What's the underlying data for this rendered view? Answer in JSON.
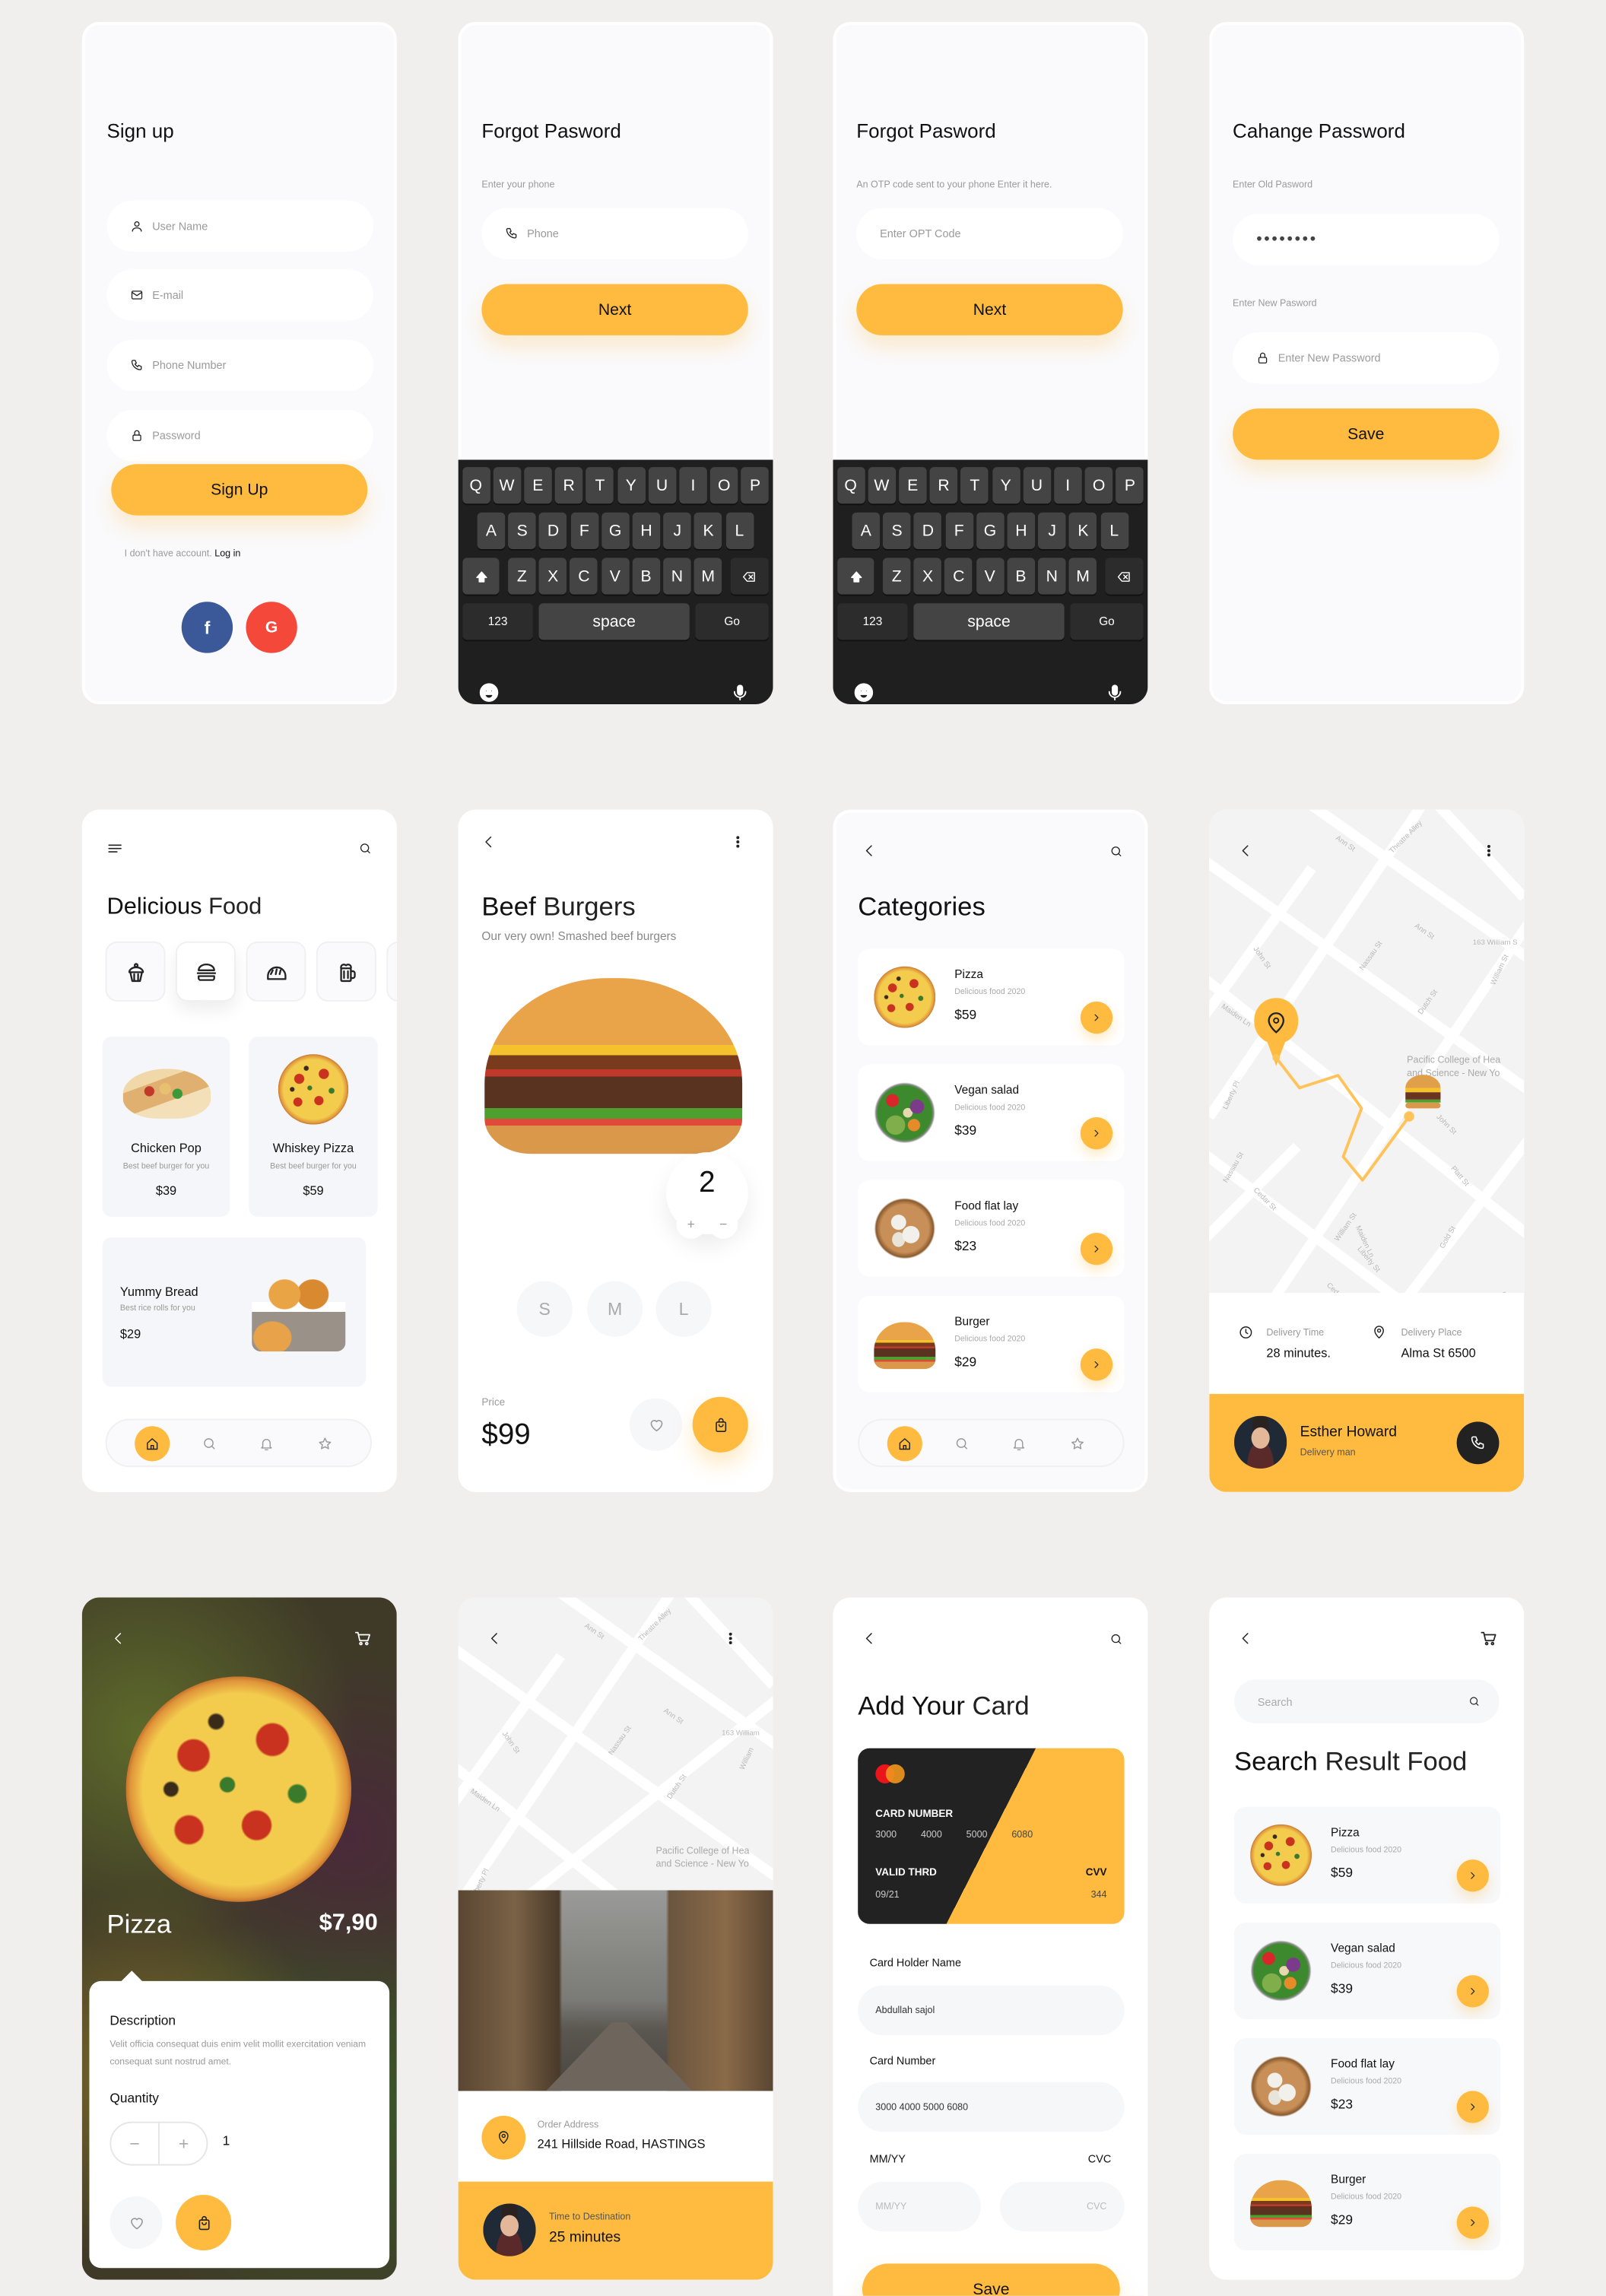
{
  "colors": {
    "accent": "#FFBB3F",
    "background": "#F0EFED",
    "keyboard": "#1F1F1F",
    "facebook": "#3B5998",
    "google": "#F4483A",
    "dark_button": "#222222"
  },
  "signup": {
    "title": "Sign up",
    "fields": [
      {
        "placeholder": "User Name",
        "icon": "user-icon"
      },
      {
        "placeholder": "E-mail",
        "icon": "mail-icon"
      },
      {
        "placeholder": "Phone Number",
        "icon": "phone-icon"
      },
      {
        "placeholder": "Password",
        "icon": "lock-icon"
      }
    ],
    "button": "Sign Up",
    "footer_text": "I don't have account.",
    "login_link": "Log in",
    "social": {
      "facebook": "f",
      "google": "G"
    }
  },
  "forgot_phone": {
    "title": "Forgot Pasword",
    "label": "Enter your phone",
    "placeholder": "Phone",
    "button": "Next"
  },
  "forgot_otp": {
    "title": "Forgot Pasword",
    "label": "An OTP code sent to your phone Enter it here.",
    "placeholder": "Enter OPT Code",
    "button": "Next"
  },
  "keyboard": {
    "rows": [
      [
        "Q",
        "W",
        "E",
        "R",
        "T",
        "Y",
        "U",
        "I",
        "O",
        "P"
      ],
      [
        "A",
        "S",
        "D",
        "F",
        "G",
        "H",
        "J",
        "K",
        "L"
      ],
      [
        "Z",
        "X",
        "C",
        "V",
        "B",
        "N",
        "M"
      ]
    ],
    "numbers": "123",
    "space": "space",
    "go": "Go"
  },
  "change_password": {
    "title": "Cahange Password",
    "old_label": "Enter Old Pasword",
    "old_value": "●●●●●●●●",
    "new_label": "Enter New Pasword",
    "new_placeholder": "Enter New Password",
    "button": "Save"
  },
  "home": {
    "title_bold": "Delicious",
    "title_light": "Food",
    "category_icons": [
      "cupcake-icon",
      "burger-icon",
      "bread-icon",
      "drink-icon"
    ],
    "selected_category": "burger-icon",
    "foods": [
      {
        "name": "Chicken Pop",
        "desc": "Best beef burger for you",
        "price": "$39",
        "image": "tacos"
      },
      {
        "name": "Whiskey Pizza",
        "desc": "Best beef burger for you",
        "price": "$59",
        "image": "pizza"
      }
    ],
    "featured": {
      "name": "Yummy Bread",
      "desc": "Best rice rolls for you",
      "price": "$29",
      "image": "bread"
    },
    "nav": [
      "home-icon",
      "search-icon",
      "bell-icon",
      "star-icon"
    ],
    "nav_active": "home-icon"
  },
  "detail": {
    "title_bold": "Beef",
    "title_light": "Burgers",
    "subtitle": "Our very own! Smashed beef burgers",
    "quantity": "2",
    "plus": "+",
    "minus": "−",
    "sizes": [
      "S",
      "M",
      "L"
    ],
    "price_label": "Price",
    "price": "$99"
  },
  "categories": {
    "title": "Categories",
    "items": [
      {
        "name": "Pizza",
        "desc": "Delicious food 2020",
        "price": "$59",
        "image": "pizza"
      },
      {
        "name": "Vegan salad",
        "desc": "Delicious food 2020",
        "price": "$39",
        "image": "salad"
      },
      {
        "name": "Food flat lay",
        "desc": "Delicious food 2020",
        "price": "$23",
        "image": "dump"
      },
      {
        "name": "Burger",
        "desc": "Delicious food 2020",
        "price": "$29",
        "image": "burger"
      }
    ]
  },
  "tracking": {
    "map_labels": [
      "Ann St",
      "Theatre Alley",
      "Ann St",
      "Nassau St",
      "John St",
      "163 William S",
      "William St",
      "Maiden Ln",
      "Dutch St",
      "Liberty Pl",
      "Pacific College of Hea",
      "and Science - New Yo",
      "John St",
      "Nassau St",
      "Platt St",
      "Cedar St",
      "William St",
      "Maiden Ln",
      "Liberty St",
      "Gold St",
      "Cedar St",
      "Pearl S"
    ],
    "delivery_time_label": "Delivery Time",
    "delivery_time": "28 minutes.",
    "delivery_place_label": "Delivery Place",
    "delivery_place": "Alma St 6500",
    "courier_name": "Esther Howard",
    "courier_role": "Delivery man"
  },
  "pizza": {
    "name": "Pizza",
    "price": "$7,90",
    "description_title": "Description",
    "description": "Velit officia consequat duis enim velit mollit exercitation veniam consequat sunt nostrud amet.",
    "quantity_label": "Quantity",
    "quantity": "1"
  },
  "order": {
    "map_labels": [
      "Ann St",
      "Theatre Alley",
      "Ann St",
      "Nassau St",
      "John St",
      "163 William",
      "William",
      "Maiden Ln",
      "Dutch St",
      "Liberty Pl",
      "Pacific College of Hea",
      "and Science - New Yo"
    ],
    "address_label": "Order Address",
    "address": "241 Hillside Road, HASTINGS",
    "time_label": "Time to Destination",
    "time": "25 minutes"
  },
  "add_card": {
    "title_bold": "Add Your",
    "title_light": "Card",
    "card": {
      "number_label": "CARD NUMBER",
      "number_groups": [
        "3000",
        "4000",
        "5000",
        "6080"
      ],
      "valid_label": "VALID THRD",
      "valid": "09/21",
      "cvv_label": "CVV",
      "cvv": "344"
    },
    "holder_label": "Card Holder Name",
    "holder_value": "Abdullah sajol",
    "number_label": "Card Number",
    "number_value": "3000 4000 5000 6080",
    "expiry_label": "MM/YY",
    "cvc_label": "CVC",
    "expiry_placeholder": "MM/YY",
    "cvc_placeholder": "CVC",
    "button": "Save"
  },
  "search": {
    "placeholder": "Search",
    "title_bold": "Search",
    "title_light": "Result Food",
    "items": [
      {
        "name": "Pizza",
        "desc": "Delicious food 2020",
        "price": "$59",
        "image": "pizza"
      },
      {
        "name": "Vegan salad",
        "desc": "Delicious food 2020",
        "price": "$39",
        "image": "salad"
      },
      {
        "name": "Food flat lay",
        "desc": "Delicious food 2020",
        "price": "$23",
        "image": "dump"
      },
      {
        "name": "Burger",
        "desc": "Delicious food 2020",
        "price": "$29",
        "image": "burger"
      }
    ]
  }
}
